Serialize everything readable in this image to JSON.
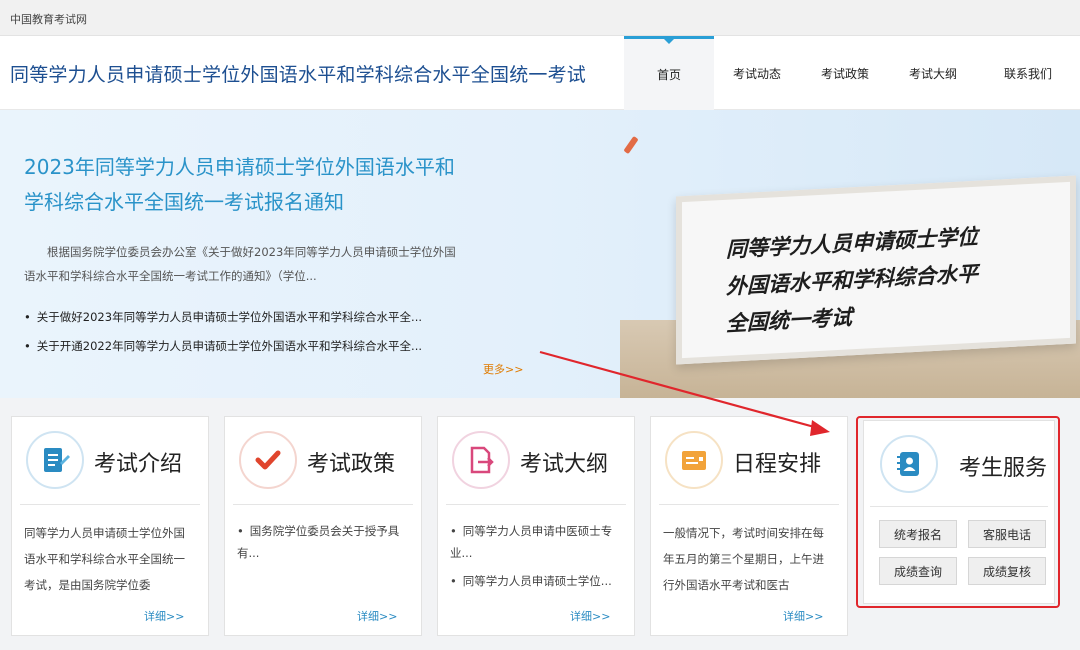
{
  "topbar": {
    "site_name": "中国教育考试网"
  },
  "header": {
    "title": "同等学力人员申请硕士学位外国语水平和学科综合水平全国统一考试",
    "nav": [
      "首页",
      "考试动态",
      "考试政策",
      "考试大纲",
      "联系我们"
    ]
  },
  "banner": {
    "headline_line1": "2023年同等学力人员申请硕士学位外国语水平和",
    "headline_line2": "学科综合水平全国统一考试报名通知",
    "intro_line1": "根据国务院学位委员会办公室《关于做好2023年同等学力人员申请硕士学位外国",
    "intro_line2": "语水平和学科综合水平全国统一考试工作的通知》（学位...",
    "links": [
      "关于做好2023年同等学力人员申请硕士学位外国语水平和学科综合水平全...",
      "关于开通2022年同等学力人员申请硕士学位外国语水平和学科综合水平全..."
    ],
    "more": "更多>>",
    "board_line1": "同等学力人员申请硕士学位",
    "board_line2": "外国语水平和学科综合水平",
    "board_line3": "全国统一考试"
  },
  "cards": {
    "intro": {
      "title": "考试介绍",
      "text": "同等学力人员申请硕士学位外国语水平和学科综合水平全国统一考试，是由国务院学位委",
      "detail": "详细>>"
    },
    "policy": {
      "title": "考试政策",
      "items": [
        "国务院学位委员会关于授予具有..."
      ],
      "detail": "详细>>"
    },
    "syllabus": {
      "title": "考试大纲",
      "items": [
        "同等学力人员申请中医硕士专业...",
        "同等学力人员申请硕士学位..."
      ],
      "detail": "详细>>"
    },
    "schedule": {
      "title": "日程安排",
      "text": "一般情况下，考试时间安排在每年五月的第三个星期日，上午进行外国语水平考试和医古",
      "detail": "详细>>"
    },
    "service": {
      "title": "考生服务",
      "buttons": [
        "统考报名",
        "客服电话",
        "成绩查询",
        "成绩复核"
      ]
    }
  },
  "colors": {
    "brand_blue": "#1d4f91",
    "accent_cyan": "#2a93c9",
    "more_orange": "#e07b00",
    "annotation_red": "#e0262c"
  }
}
